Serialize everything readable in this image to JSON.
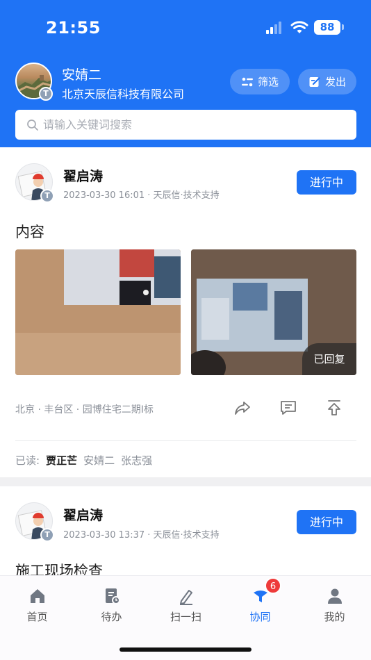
{
  "status_bar": {
    "time": "21:55",
    "battery": "88"
  },
  "user": {
    "name": "安婧二",
    "company": "北京天辰信科技有限公司",
    "badge": "T"
  },
  "header_buttons": {
    "filter": "筛选",
    "post": "发出"
  },
  "search": {
    "placeholder": "请输入关键词搜索"
  },
  "posts": [
    {
      "author": "翟启涛",
      "badge": "T",
      "meta": "2023-03-30 16:01 · 天辰信·技术支持",
      "status": "进行中",
      "title": "内容",
      "photo_tag": "已回复",
      "location": "北京 · 丰台区 · 园博住宅二期I标",
      "read_label": "已读:",
      "readers": [
        "贾正芒",
        "安婧二",
        "张志强"
      ]
    },
    {
      "author": "翟启涛",
      "badge": "T",
      "meta": "2023-03-30 13:37 · 天辰信·技术支持",
      "status": "进行中",
      "title": "施工现场检查"
    }
  ],
  "tabs": [
    {
      "label": "首页",
      "icon": "home-icon"
    },
    {
      "label": "待办",
      "icon": "todo-icon"
    },
    {
      "label": "扫一扫",
      "icon": "scan-icon"
    },
    {
      "label": "协同",
      "icon": "collaborate-icon",
      "badge": "6"
    },
    {
      "label": "我的",
      "icon": "profile-icon"
    }
  ],
  "colors": {
    "primary": "#1f73f5",
    "badge": "#ee3b3b"
  }
}
